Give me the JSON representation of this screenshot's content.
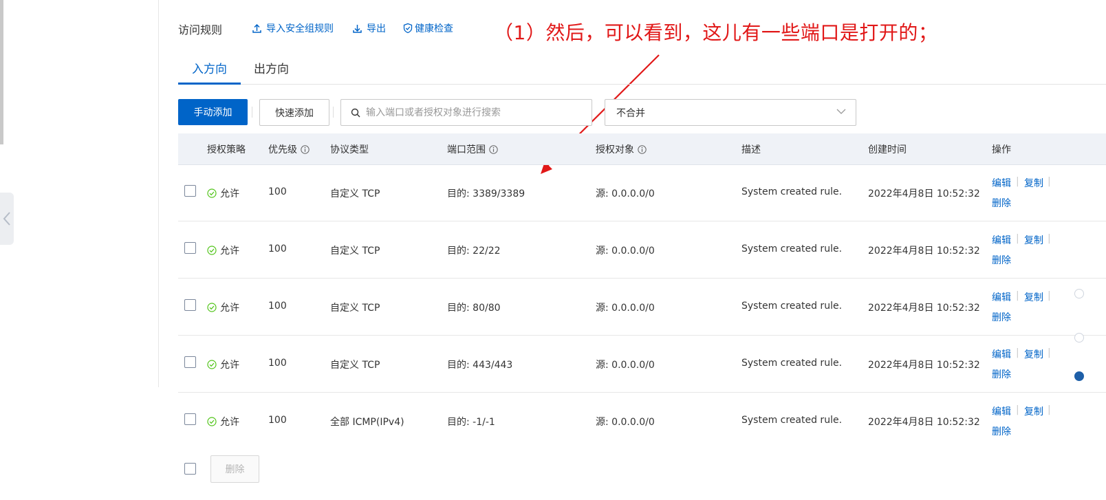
{
  "header": {
    "title": "访问规则",
    "links": [
      {
        "label": "导入安全组规则",
        "icon": "import-icon"
      },
      {
        "label": "导出",
        "icon": "export-icon"
      },
      {
        "label": "健康检查",
        "icon": "shield-check-icon"
      }
    ]
  },
  "annotation": "（1）然后，可以看到，这儿有一些端口是打开的；",
  "tabs": [
    {
      "label": "入方向",
      "active": true
    },
    {
      "label": "出方向",
      "active": false
    }
  ],
  "toolbar": {
    "manual_add": "手动添加",
    "quick_add": "快速添加",
    "search_placeholder": "输入端口或者授权对象进行搜索",
    "merge_select": "不合并"
  },
  "table": {
    "columns": [
      "授权策略",
      "优先级",
      "协议类型",
      "端口范围",
      "授权对象",
      "描述",
      "创建时间",
      "操作"
    ],
    "rows": [
      {
        "policy": "允许",
        "priority": "100",
        "protocol": "自定义 TCP",
        "port": "目的: 3389/3389",
        "source": "源: 0.0.0.0/0",
        "desc": "System created rule.",
        "created": "2022年4月8日 10:52:32"
      },
      {
        "policy": "允许",
        "priority": "100",
        "protocol": "自定义 TCP",
        "port": "目的: 22/22",
        "source": "源: 0.0.0.0/0",
        "desc": "System created rule.",
        "created": "2022年4月8日 10:52:32"
      },
      {
        "policy": "允许",
        "priority": "100",
        "protocol": "自定义 TCP",
        "port": "目的: 80/80",
        "source": "源: 0.0.0.0/0",
        "desc": "System created rule.",
        "created": "2022年4月8日 10:52:32"
      },
      {
        "policy": "允许",
        "priority": "100",
        "protocol": "自定义 TCP",
        "port": "目的: 443/443",
        "source": "源: 0.0.0.0/0",
        "desc": "System created rule.",
        "created": "2022年4月8日 10:52:32"
      },
      {
        "policy": "允许",
        "priority": "100",
        "protocol": "全部 ICMP(IPv4)",
        "port": "目的: -1/-1",
        "source": "源: 0.0.0.0/0",
        "desc": "System created rule.",
        "created": "2022年4月8日 10:52:32"
      }
    ],
    "actions": {
      "edit": "编辑",
      "copy": "复制",
      "delete": "删除"
    }
  },
  "footer": {
    "delete_label": "删除"
  },
  "colors": {
    "accent": "#0064c8",
    "allow": "#52c41a",
    "annotation": "#e11818"
  }
}
